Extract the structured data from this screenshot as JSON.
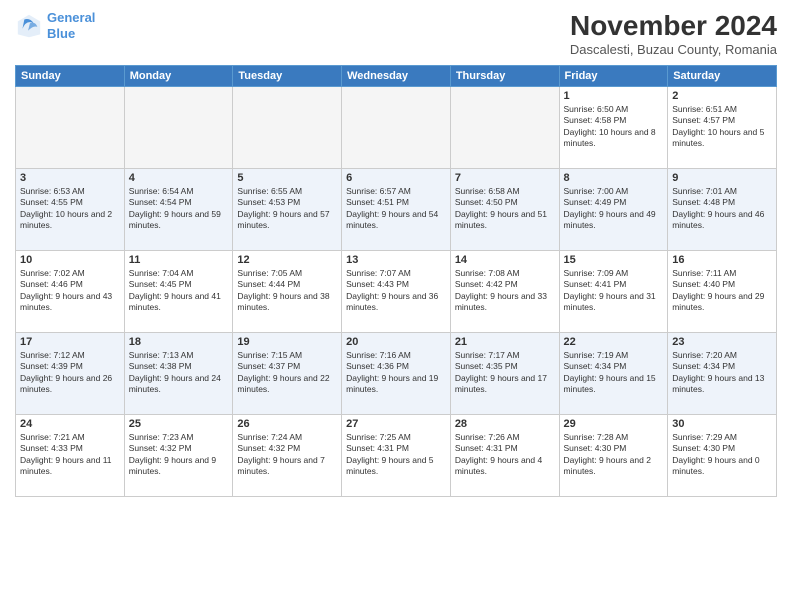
{
  "header": {
    "logo_line1": "General",
    "logo_line2": "Blue",
    "month_title": "November 2024",
    "subtitle": "Dascalesti, Buzau County, Romania"
  },
  "weekdays": [
    "Sunday",
    "Monday",
    "Tuesday",
    "Wednesday",
    "Thursday",
    "Friday",
    "Saturday"
  ],
  "weeks": [
    [
      {
        "day": "",
        "info": ""
      },
      {
        "day": "",
        "info": ""
      },
      {
        "day": "",
        "info": ""
      },
      {
        "day": "",
        "info": ""
      },
      {
        "day": "",
        "info": ""
      },
      {
        "day": "1",
        "info": "Sunrise: 6:50 AM\nSunset: 4:58 PM\nDaylight: 10 hours and 8 minutes."
      },
      {
        "day": "2",
        "info": "Sunrise: 6:51 AM\nSunset: 4:57 PM\nDaylight: 10 hours and 5 minutes."
      }
    ],
    [
      {
        "day": "3",
        "info": "Sunrise: 6:53 AM\nSunset: 4:55 PM\nDaylight: 10 hours and 2 minutes."
      },
      {
        "day": "4",
        "info": "Sunrise: 6:54 AM\nSunset: 4:54 PM\nDaylight: 9 hours and 59 minutes."
      },
      {
        "day": "5",
        "info": "Sunrise: 6:55 AM\nSunset: 4:53 PM\nDaylight: 9 hours and 57 minutes."
      },
      {
        "day": "6",
        "info": "Sunrise: 6:57 AM\nSunset: 4:51 PM\nDaylight: 9 hours and 54 minutes."
      },
      {
        "day": "7",
        "info": "Sunrise: 6:58 AM\nSunset: 4:50 PM\nDaylight: 9 hours and 51 minutes."
      },
      {
        "day": "8",
        "info": "Sunrise: 7:00 AM\nSunset: 4:49 PM\nDaylight: 9 hours and 49 minutes."
      },
      {
        "day": "9",
        "info": "Sunrise: 7:01 AM\nSunset: 4:48 PM\nDaylight: 9 hours and 46 minutes."
      }
    ],
    [
      {
        "day": "10",
        "info": "Sunrise: 7:02 AM\nSunset: 4:46 PM\nDaylight: 9 hours and 43 minutes."
      },
      {
        "day": "11",
        "info": "Sunrise: 7:04 AM\nSunset: 4:45 PM\nDaylight: 9 hours and 41 minutes."
      },
      {
        "day": "12",
        "info": "Sunrise: 7:05 AM\nSunset: 4:44 PM\nDaylight: 9 hours and 38 minutes."
      },
      {
        "day": "13",
        "info": "Sunrise: 7:07 AM\nSunset: 4:43 PM\nDaylight: 9 hours and 36 minutes."
      },
      {
        "day": "14",
        "info": "Sunrise: 7:08 AM\nSunset: 4:42 PM\nDaylight: 9 hours and 33 minutes."
      },
      {
        "day": "15",
        "info": "Sunrise: 7:09 AM\nSunset: 4:41 PM\nDaylight: 9 hours and 31 minutes."
      },
      {
        "day": "16",
        "info": "Sunrise: 7:11 AM\nSunset: 4:40 PM\nDaylight: 9 hours and 29 minutes."
      }
    ],
    [
      {
        "day": "17",
        "info": "Sunrise: 7:12 AM\nSunset: 4:39 PM\nDaylight: 9 hours and 26 minutes."
      },
      {
        "day": "18",
        "info": "Sunrise: 7:13 AM\nSunset: 4:38 PM\nDaylight: 9 hours and 24 minutes."
      },
      {
        "day": "19",
        "info": "Sunrise: 7:15 AM\nSunset: 4:37 PM\nDaylight: 9 hours and 22 minutes."
      },
      {
        "day": "20",
        "info": "Sunrise: 7:16 AM\nSunset: 4:36 PM\nDaylight: 9 hours and 19 minutes."
      },
      {
        "day": "21",
        "info": "Sunrise: 7:17 AM\nSunset: 4:35 PM\nDaylight: 9 hours and 17 minutes."
      },
      {
        "day": "22",
        "info": "Sunrise: 7:19 AM\nSunset: 4:34 PM\nDaylight: 9 hours and 15 minutes."
      },
      {
        "day": "23",
        "info": "Sunrise: 7:20 AM\nSunset: 4:34 PM\nDaylight: 9 hours and 13 minutes."
      }
    ],
    [
      {
        "day": "24",
        "info": "Sunrise: 7:21 AM\nSunset: 4:33 PM\nDaylight: 9 hours and 11 minutes."
      },
      {
        "day": "25",
        "info": "Sunrise: 7:23 AM\nSunset: 4:32 PM\nDaylight: 9 hours and 9 minutes."
      },
      {
        "day": "26",
        "info": "Sunrise: 7:24 AM\nSunset: 4:32 PM\nDaylight: 9 hours and 7 minutes."
      },
      {
        "day": "27",
        "info": "Sunrise: 7:25 AM\nSunset: 4:31 PM\nDaylight: 9 hours and 5 minutes."
      },
      {
        "day": "28",
        "info": "Sunrise: 7:26 AM\nSunset: 4:31 PM\nDaylight: 9 hours and 4 minutes."
      },
      {
        "day": "29",
        "info": "Sunrise: 7:28 AM\nSunset: 4:30 PM\nDaylight: 9 hours and 2 minutes."
      },
      {
        "day": "30",
        "info": "Sunrise: 7:29 AM\nSunset: 4:30 PM\nDaylight: 9 hours and 0 minutes."
      }
    ]
  ]
}
